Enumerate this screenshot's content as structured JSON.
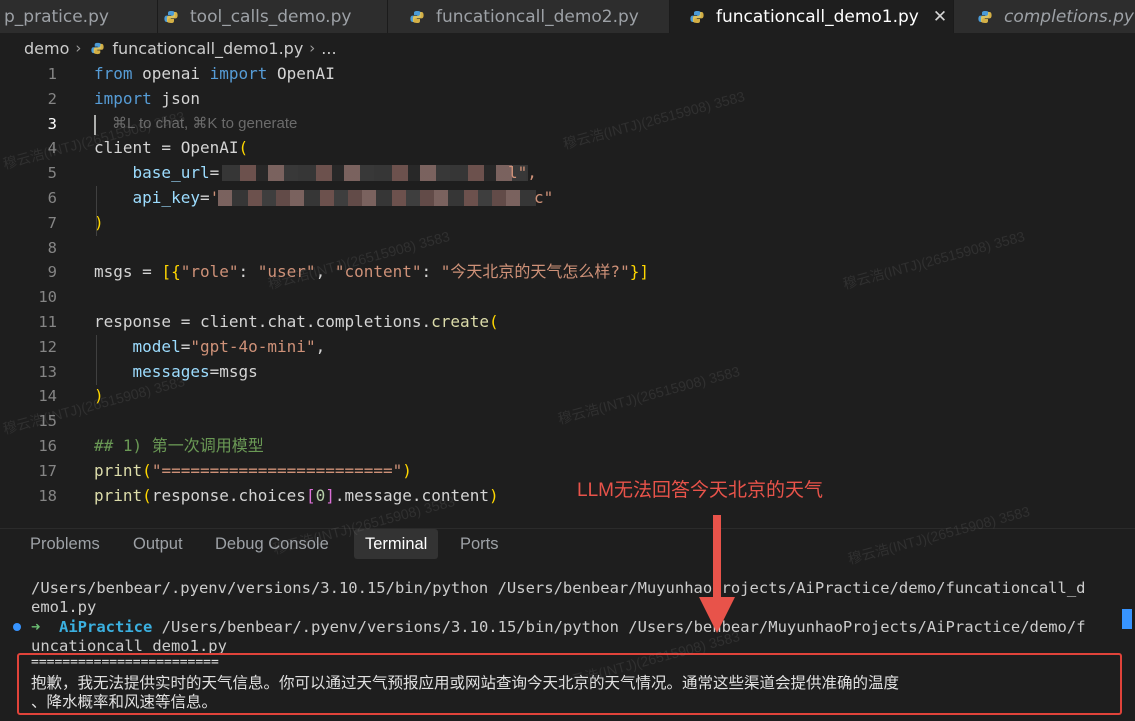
{
  "tabs": [
    {
      "label": "p_pratice.py",
      "active": false
    },
    {
      "label": "tool_calls_demo.py",
      "active": false
    },
    {
      "label": "funcationcall_demo2.py",
      "active": false
    },
    {
      "label": "funcationcall_demo1.py",
      "active": true
    },
    {
      "label": "completions.py",
      "active": false
    }
  ],
  "tab_close_glyph": "✕",
  "breadcrumb": {
    "folder": "demo",
    "file": "funcationcall_demo1.py",
    "more": "..."
  },
  "editor": {
    "line_numbers": [
      "1",
      "2",
      "3",
      "4",
      "5",
      "6",
      "7",
      "8",
      "9",
      "10",
      "11",
      "12",
      "13",
      "14",
      "15",
      "16",
      "17",
      "18"
    ],
    "code": {
      "l1": {
        "kw1": "from",
        "mod": " openai ",
        "kw2": "import",
        "cls": " OpenAI"
      },
      "l2": {
        "kw": "import",
        "mod": " json"
      },
      "l3_hint": "⌘L to chat, ⌘K to generate",
      "l4": {
        "var": "client",
        "op": " = ",
        "cls": "OpenAI",
        "paren": "("
      },
      "l5": {
        "param": "base_url",
        "eq": "=",
        "str_tail": "l\","
      },
      "l6": {
        "param": "api_key",
        "eq": "=",
        "str_head": "'",
        "str_tail": "c\""
      },
      "l7": {
        "paren": ")"
      },
      "l9": {
        "var": "msgs",
        "op": " = ",
        "open": "[{",
        "k1": "\"role\"",
        "c1": ": ",
        "v1": "\"user\"",
        "c2": ", ",
        "k2": "\"content\"",
        "c3": ": ",
        "v2": "\"今天北京的天气怎么样?\"",
        "close": "}]"
      },
      "l11": {
        "var": "response",
        "op": " = ",
        "obj": "client.chat.completions.",
        "fn": "create",
        "paren": "("
      },
      "l12": {
        "param": "model",
        "eq": "=",
        "str": "\"gpt-4o-mini\"",
        "comma": ","
      },
      "l13": {
        "param": "messages",
        "eq": "=",
        "val": "msgs"
      },
      "l14": {
        "paren": ")"
      },
      "l16": {
        "comment": "## 1) 第一次调用模型"
      },
      "l17": {
        "fn": "print",
        "open": "(",
        "str": "\"========================\"",
        "close": ")"
      },
      "l18": {
        "fn": "print",
        "open": "(",
        "obj": "response.choices",
        "bopen": "[",
        "idx": "0",
        "bclose": "]",
        "tail": ".message.content",
        "close": ")"
      }
    }
  },
  "annotation": "LLM无法回答今天北京的天气",
  "panel": {
    "tabs": [
      "Problems",
      "Output",
      "Debug Console",
      "Terminal",
      "Ports"
    ],
    "active_tab": "Terminal",
    "terminal": {
      "line1": "/Users/benbear/.pyenv/versions/3.10.15/bin/python /Users/benbear/MuyunhaoProjects/AiPractice/demo/funcationcall_d",
      "line2": "emo1.py",
      "prompt_arrow": "➜",
      "prompt_dir": "AiPractice",
      "line3": " /Users/benbear/.pyenv/versions/3.10.15/bin/python /Users/benbear/MuyunhaoProjects/AiPractice/demo/f",
      "line4": "uncationcall_demo1.py",
      "output_sep": "========================",
      "output1": "抱歉，我无法提供实时的天气信息。你可以通过天气预报应用或网站查询今天北京的天气情况。通常这些渠道会提供准确的温度",
      "output2": "、降水概率和风速等信息。"
    }
  },
  "watermark": "穆云浩(INTJ)(26515908) 3583",
  "colors": {
    "annotation": "#e8534a",
    "accent": "#3794ff"
  }
}
